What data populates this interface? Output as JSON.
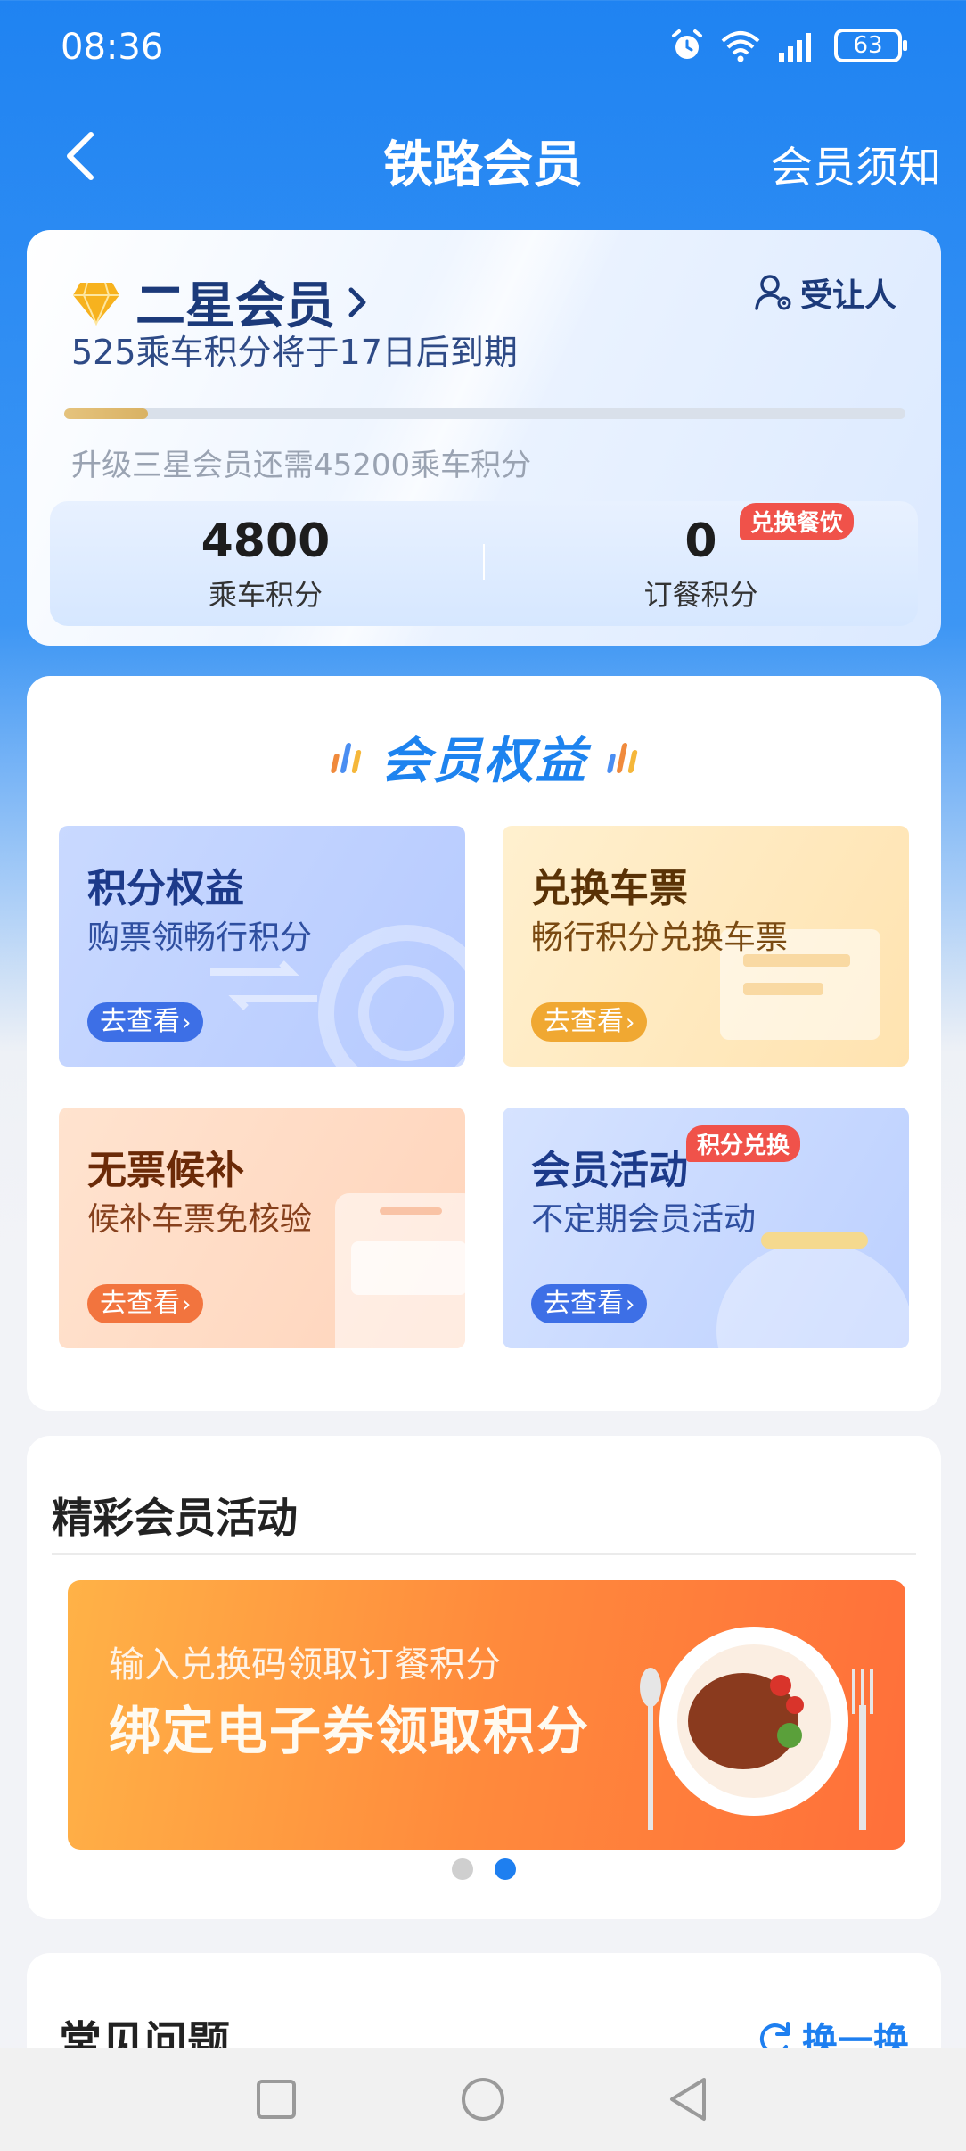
{
  "status_bar": {
    "time": "08:36",
    "battery": "63"
  },
  "header": {
    "title": "铁路会员",
    "right_link": "会员须知"
  },
  "member_card": {
    "level": "二星会员",
    "transfer_label": "受让人",
    "expiry_notice": "525乘车积分将于17日后到期",
    "upgrade_notice": "升级三星会员还需45200乘车积分",
    "progress_fraction": 0.1,
    "ride_points": {
      "value": "4800",
      "label": "乘车积分"
    },
    "meal_points": {
      "value": "0",
      "label": "订餐积分",
      "badge": "兑换餐饮"
    }
  },
  "benefits": {
    "title": "会员权益",
    "tiles": [
      {
        "title": "积分权益",
        "subtitle": "购票领畅行积分",
        "button": "去查看"
      },
      {
        "title": "兑换车票",
        "subtitle": "畅行积分兑换车票",
        "button": "去查看"
      },
      {
        "title": "无票候补",
        "subtitle": "候补车票免核验",
        "button": "去查看"
      },
      {
        "title": "会员活动",
        "subtitle": "不定期会员活动",
        "button": "去查看",
        "badge": "积分兑换"
      }
    ]
  },
  "activities": {
    "title": "精彩会员活动",
    "banner": {
      "subtitle": "输入兑换码领取订餐积分",
      "headline": "绑定电子券领取积分"
    },
    "carousel": {
      "count": 2,
      "active": 1
    }
  },
  "faq": {
    "title": "常见问题",
    "refresh_label": "换一换"
  },
  "colors": {
    "primary": "#1e7ff0",
    "badge": "#f0524a",
    "gold": "#e5c37d"
  }
}
